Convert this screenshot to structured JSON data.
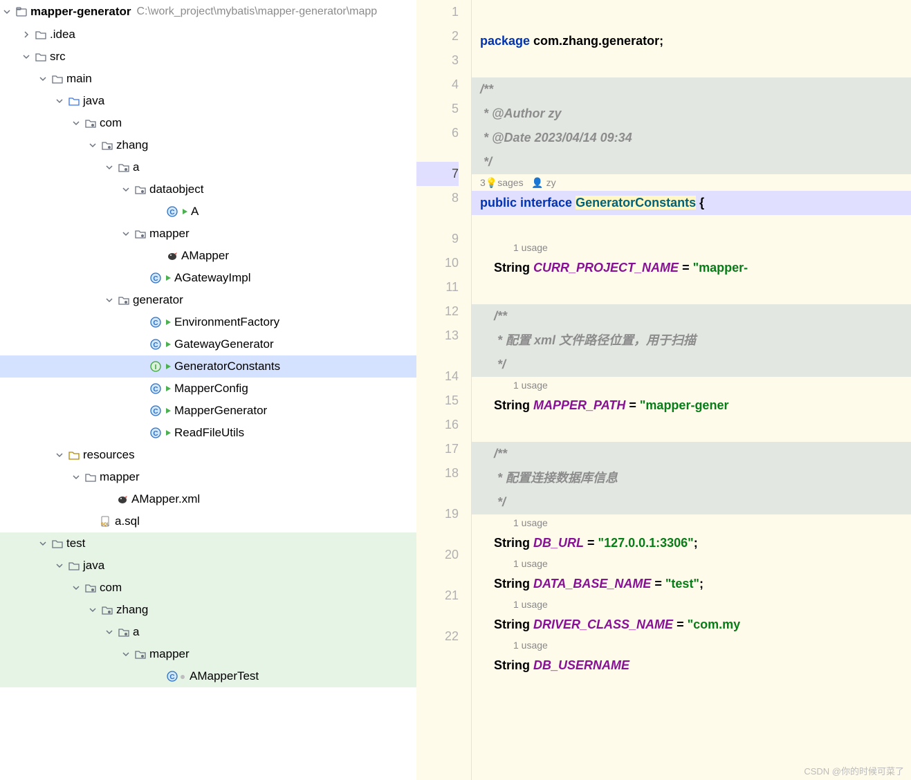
{
  "tree": {
    "root": {
      "name": "mapper-generator",
      "path": "C:\\work_project\\mybatis\\mapper-generator\\mapp"
    },
    "items": [
      {
        "label": ".idea",
        "indent": 28,
        "icon": "folder",
        "chevron": "right"
      },
      {
        "label": "src",
        "indent": 28,
        "icon": "folder",
        "chevron": "down"
      },
      {
        "label": "main",
        "indent": 52,
        "icon": "folder",
        "chevron": "down"
      },
      {
        "label": "java",
        "indent": 76,
        "icon": "folder-blue",
        "chevron": "down"
      },
      {
        "label": "com",
        "indent": 100,
        "icon": "package",
        "chevron": "down"
      },
      {
        "label": "zhang",
        "indent": 124,
        "icon": "package",
        "chevron": "down"
      },
      {
        "label": "a",
        "indent": 148,
        "icon": "package",
        "chevron": "down"
      },
      {
        "label": "dataobject",
        "indent": 172,
        "icon": "package",
        "chevron": "down"
      },
      {
        "label": "A",
        "indent": 218,
        "icon": "class",
        "chevron": "",
        "run": true
      },
      {
        "label": "mapper",
        "indent": 172,
        "icon": "package",
        "chevron": "down"
      },
      {
        "label": "AMapper",
        "indent": 218,
        "icon": "bird",
        "chevron": ""
      },
      {
        "label": "AGatewayImpl",
        "indent": 194,
        "icon": "class",
        "chevron": "",
        "run": true
      },
      {
        "label": "generator",
        "indent": 148,
        "icon": "package",
        "chevron": "down"
      },
      {
        "label": "EnvironmentFactory",
        "indent": 194,
        "icon": "class",
        "chevron": "",
        "run": true
      },
      {
        "label": "GatewayGenerator",
        "indent": 194,
        "icon": "class",
        "chevron": "",
        "run": true
      },
      {
        "label": "GeneratorConstants",
        "indent": 194,
        "icon": "interface",
        "chevron": "",
        "run": true,
        "selected": true
      },
      {
        "label": "MapperConfig",
        "indent": 194,
        "icon": "class",
        "chevron": "",
        "run": true
      },
      {
        "label": "MapperGenerator",
        "indent": 194,
        "icon": "class",
        "chevron": "",
        "run": true
      },
      {
        "label": "ReadFileUtils",
        "indent": 194,
        "icon": "class",
        "chevron": "",
        "run": true
      },
      {
        "label": "resources",
        "indent": 76,
        "icon": "folder-yellow",
        "chevron": "down"
      },
      {
        "label": "mapper",
        "indent": 100,
        "icon": "folder",
        "chevron": "down"
      },
      {
        "label": "AMapper.xml",
        "indent": 146,
        "icon": "bird",
        "chevron": ""
      },
      {
        "label": "a.sql",
        "indent": 122,
        "icon": "sql",
        "chevron": ""
      },
      {
        "label": "test",
        "indent": 52,
        "icon": "folder",
        "chevron": "down",
        "green": true
      },
      {
        "label": "java",
        "indent": 76,
        "icon": "folder-green",
        "chevron": "down",
        "green": true
      },
      {
        "label": "com",
        "indent": 100,
        "icon": "package",
        "chevron": "down",
        "green": true
      },
      {
        "label": "zhang",
        "indent": 124,
        "icon": "package",
        "chevron": "down",
        "green": true
      },
      {
        "label": "a",
        "indent": 148,
        "icon": "package",
        "chevron": "down",
        "green": true
      },
      {
        "label": "mapper",
        "indent": 172,
        "icon": "package",
        "chevron": "down",
        "green": true
      },
      {
        "label": "AMapperTest",
        "indent": 218,
        "icon": "class",
        "chevron": "",
        "green": true,
        "dot": true
      }
    ]
  },
  "editor": {
    "hints": {
      "usages_top": "3 usages",
      "author_top": "zy",
      "bulb": "💡",
      "one_usage": "1 usage"
    },
    "watermark": "CSDN @你的时候可菜了",
    "lines": [
      {
        "n": 1,
        "tokens": [
          [
            "kw",
            "package"
          ],
          [
            "",
            " com.zhang.generator;"
          ]
        ]
      },
      {
        "n": 2,
        "tokens": []
      },
      {
        "n": 3,
        "comment": true,
        "tokens": [
          [
            "com",
            "/**"
          ]
        ]
      },
      {
        "n": 4,
        "comment": true,
        "tokens": [
          [
            "com",
            " * @Author zy"
          ]
        ]
      },
      {
        "n": 5,
        "comment": true,
        "tokens": [
          [
            "com",
            " * @Date 2023/04/14 09:34"
          ]
        ]
      },
      {
        "n": 6,
        "comment": true,
        "tokens": [
          [
            "com",
            " */"
          ]
        ]
      },
      {
        "hint": "usages-author"
      },
      {
        "n": 7,
        "current": true,
        "tokens": [
          [
            "kw",
            "public"
          ],
          [
            "",
            " "
          ],
          [
            "kw",
            "interface"
          ],
          [
            "",
            " "
          ],
          [
            "iface-name",
            "GeneratorConstants"
          ],
          [
            "",
            " {"
          ]
        ]
      },
      {
        "n": 8,
        "tokens": []
      },
      {
        "hint": "one-usage",
        "indent": 48
      },
      {
        "n": 9,
        "tokens": [
          [
            "",
            "    String "
          ],
          [
            "field",
            "CURR_PROJECT_NAME"
          ],
          [
            "",
            " = "
          ],
          [
            "str",
            "\"mapper-"
          ]
        ]
      },
      {
        "n": 10,
        "tokens": []
      },
      {
        "n": 11,
        "comment": true,
        "tokens": [
          [
            "",
            "    "
          ],
          [
            "com",
            "/**"
          ]
        ]
      },
      {
        "n": 12,
        "comment": true,
        "tokens": [
          [
            "",
            "    "
          ],
          [
            "com",
            " * 配置 xml 文件路径位置，用于扫描"
          ]
        ]
      },
      {
        "n": 13,
        "comment": true,
        "tokens": [
          [
            "",
            "    "
          ],
          [
            "com",
            " */"
          ]
        ]
      },
      {
        "hint": "one-usage",
        "indent": 48
      },
      {
        "n": 14,
        "tokens": [
          [
            "",
            "    String "
          ],
          [
            "field",
            "MAPPER_PATH"
          ],
          [
            "",
            " = "
          ],
          [
            "str",
            "\"mapper-gener"
          ]
        ]
      },
      {
        "n": 15,
        "tokens": []
      },
      {
        "n": 16,
        "comment": true,
        "tokens": [
          [
            "",
            "    "
          ],
          [
            "com",
            "/**"
          ]
        ]
      },
      {
        "n": 17,
        "comment": true,
        "tokens": [
          [
            "",
            "    "
          ],
          [
            "com",
            " * 配置连接数据库信息"
          ]
        ]
      },
      {
        "n": 18,
        "comment": true,
        "tokens": [
          [
            "",
            "    "
          ],
          [
            "com",
            " */"
          ]
        ]
      },
      {
        "hint": "one-usage",
        "indent": 48
      },
      {
        "n": 19,
        "tokens": [
          [
            "",
            "    String "
          ],
          [
            "field",
            "DB_URL"
          ],
          [
            "",
            " = "
          ],
          [
            "str",
            "\"127.0.0.1:3306\""
          ],
          [
            "",
            ";"
          ]
        ]
      },
      {
        "hint": "one-usage",
        "indent": 48
      },
      {
        "n": 20,
        "tokens": [
          [
            "",
            "    String "
          ],
          [
            "field",
            "DATA_BASE_NAME"
          ],
          [
            "",
            " = "
          ],
          [
            "str",
            "\"test\""
          ],
          [
            "",
            ";"
          ]
        ]
      },
      {
        "hint": "one-usage",
        "indent": 48
      },
      {
        "n": 21,
        "tokens": [
          [
            "",
            "    String "
          ],
          [
            "field",
            "DRIVER_CLASS_NAME"
          ],
          [
            "",
            " = "
          ],
          [
            "str",
            "\"com.my"
          ]
        ]
      },
      {
        "hint": "one-usage",
        "indent": 48
      },
      {
        "n": 22,
        "tokens": [
          [
            "",
            "    String "
          ],
          [
            "field",
            "DB_USERNAME"
          ]
        ]
      }
    ]
  }
}
